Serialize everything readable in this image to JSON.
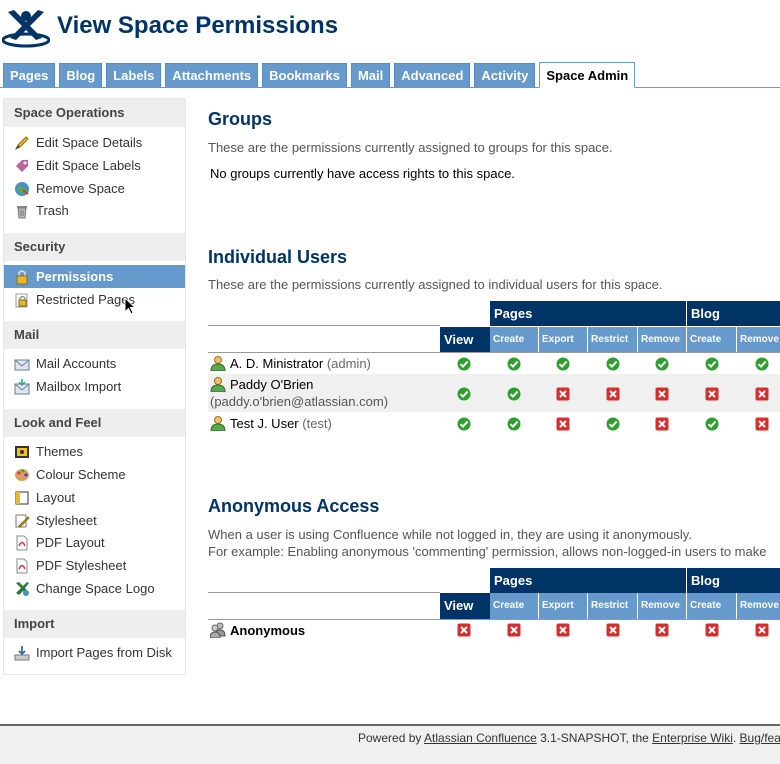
{
  "header": {
    "title": "View Space Permissions"
  },
  "tabs": [
    "Pages",
    "Blog",
    "Labels",
    "Attachments",
    "Bookmarks",
    "Mail",
    "Advanced",
    "Activity",
    "Space Admin"
  ],
  "active_tab": "Space Admin",
  "sidebar": {
    "sections": [
      {
        "title": "Space Operations",
        "items": [
          {
            "label": "Edit Space Details",
            "icon": "pencil-icon"
          },
          {
            "label": "Edit Space Labels",
            "icon": "label-icon"
          },
          {
            "label": "Remove Space",
            "icon": "globe-icon"
          },
          {
            "label": "Trash",
            "icon": "trash-icon"
          }
        ]
      },
      {
        "title": "Security",
        "items": [
          {
            "label": "Permissions",
            "icon": "lock-icon",
            "active": true
          },
          {
            "label": "Restricted Pages",
            "icon": "restricted-lock-icon"
          }
        ]
      },
      {
        "title": "Mail",
        "items": [
          {
            "label": "Mail Accounts",
            "icon": "mail-accounts-icon"
          },
          {
            "label": "Mailbox Import",
            "icon": "mailbox-import-icon"
          }
        ]
      },
      {
        "title": "Look and Feel",
        "items": [
          {
            "label": "Themes",
            "icon": "themes-icon"
          },
          {
            "label": "Colour Scheme",
            "icon": "palette-icon"
          },
          {
            "label": "Layout",
            "icon": "layout-icon"
          },
          {
            "label": "Stylesheet",
            "icon": "stylesheet-icon"
          },
          {
            "label": "PDF Layout",
            "icon": "pdf-icon"
          },
          {
            "label": "PDF Stylesheet",
            "icon": "pdf-icon"
          },
          {
            "label": "Change Space Logo",
            "icon": "logo-change-icon"
          }
        ]
      },
      {
        "title": "Import",
        "items": [
          {
            "label": "Import Pages from Disk",
            "icon": "import-disk-icon"
          }
        ]
      }
    ]
  },
  "groups": {
    "title": "Groups",
    "description": "These are the permissions currently assigned to groups for this space.",
    "empty_text": "No groups currently have access rights to this space."
  },
  "individual_users": {
    "title": "Individual Users",
    "description": "These are the permissions currently assigned to individual users for this space.",
    "column_groups": [
      "Pages",
      "Blog"
    ],
    "view_header": "View",
    "sub_headers": [
      "Create",
      "Export",
      "Restrict",
      "Remove",
      "Create",
      "Remove"
    ],
    "rows": [
      {
        "name": "A. D. Ministrator",
        "username": "(admin)",
        "email": "",
        "perms": [
          true,
          true,
          true,
          true,
          true,
          true,
          true
        ]
      },
      {
        "name": "Paddy O'Brien",
        "username": "",
        "email": "(paddy.o'brien@atlassian.com)",
        "perms": [
          true,
          true,
          false,
          false,
          false,
          false,
          false
        ]
      },
      {
        "name": "Test J. User",
        "username": "(test)",
        "email": "",
        "perms": [
          true,
          true,
          false,
          true,
          false,
          true,
          false
        ]
      }
    ]
  },
  "anonymous": {
    "title": "Anonymous Access",
    "description_1": "When a user is using Confluence while not logged in, they are using it anonymously.",
    "description_2": "For example: Enabling anonymous 'commenting' permission, allows non-logged-in users to make",
    "column_groups": [
      "Pages",
      "Blog"
    ],
    "view_header": "View",
    "sub_headers": [
      "Create",
      "Export",
      "Restrict",
      "Remove",
      "Create",
      "Remove"
    ],
    "row": {
      "name": "Anonymous",
      "perms": [
        false,
        false,
        false,
        false,
        false,
        false,
        false
      ]
    }
  },
  "footer": {
    "prefix": "Powered by ",
    "link1": "Atlassian Confluence",
    "middle": " 3.1-SNAPSHOT, the ",
    "link2": "Enterprise Wiki",
    "sep": ". ",
    "link3": "Bug/fea"
  },
  "colors": {
    "brand": "#003366",
    "accent": "#6699cc",
    "check": "#2e9e2e",
    "cross": "#d32f2f"
  }
}
